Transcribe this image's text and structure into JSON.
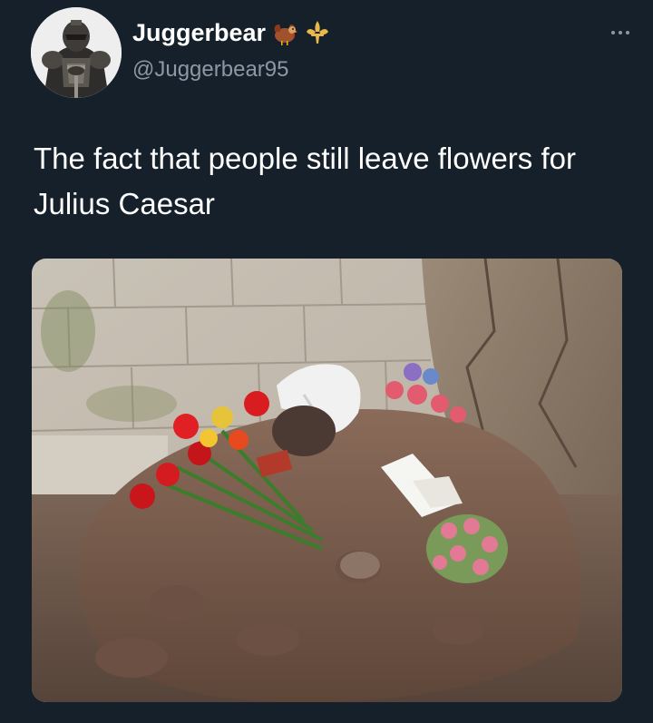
{
  "tweet": {
    "display_name": "Juggerbear",
    "name_emojis": [
      "turkey-emoji",
      "fleur-de-lis-emoji"
    ],
    "handle": "@Juggerbear95",
    "text": "The fact that people still leave flowers for Julius Caesar",
    "more_icon": "ellipsis-icon",
    "media_description_icon": "photo"
  },
  "colors": {
    "background": "#15202b",
    "primary_text": "#ffffff",
    "secondary_text": "#8b98a5",
    "fleur_de_lis": "#e8b84a"
  }
}
